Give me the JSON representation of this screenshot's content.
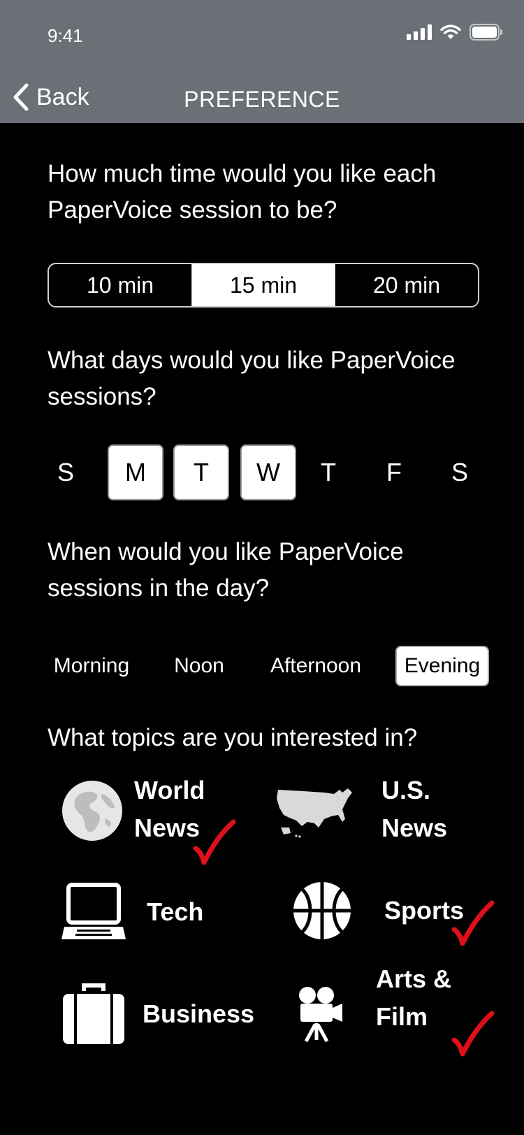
{
  "status": {
    "time": "9:41"
  },
  "nav": {
    "back_label": "Back",
    "title": "PREFERENCE"
  },
  "session_length": {
    "question": "How much time would you like each PaperVoice session to be?",
    "options": [
      "10 min",
      "15 min",
      "20 min"
    ],
    "selected": "15 min"
  },
  "days": {
    "question": "What days would you like PaperVoice sessions?",
    "items": [
      "S",
      "M",
      "T",
      "W",
      "T",
      "F",
      "S"
    ],
    "selected": [
      "M",
      "T",
      "W"
    ]
  },
  "time_of_day": {
    "question": "When would you like PaperVoice sessions in the day?",
    "options": [
      "Morning",
      "Noon",
      "Afternoon",
      "Evening"
    ],
    "selected": "Evening"
  },
  "topics": {
    "question": "What topics are you interested in?",
    "items": [
      {
        "label": "World\nNews",
        "icon": "globe-icon",
        "checked": true
      },
      {
        "label": "U.S.\nNews",
        "icon": "us-map-icon",
        "checked": false
      },
      {
        "label": "Tech",
        "icon": "laptop-icon",
        "checked": false
      },
      {
        "label": "Sports",
        "icon": "basketball-icon",
        "checked": true
      },
      {
        "label": "Business",
        "icon": "briefcase-icon",
        "checked": false
      },
      {
        "label": "Arts &\nFilm",
        "icon": "movie-camera-icon",
        "checked": true
      }
    ]
  },
  "colors": {
    "header": "#6b7077",
    "background": "#000000",
    "check": "#e0101a"
  }
}
